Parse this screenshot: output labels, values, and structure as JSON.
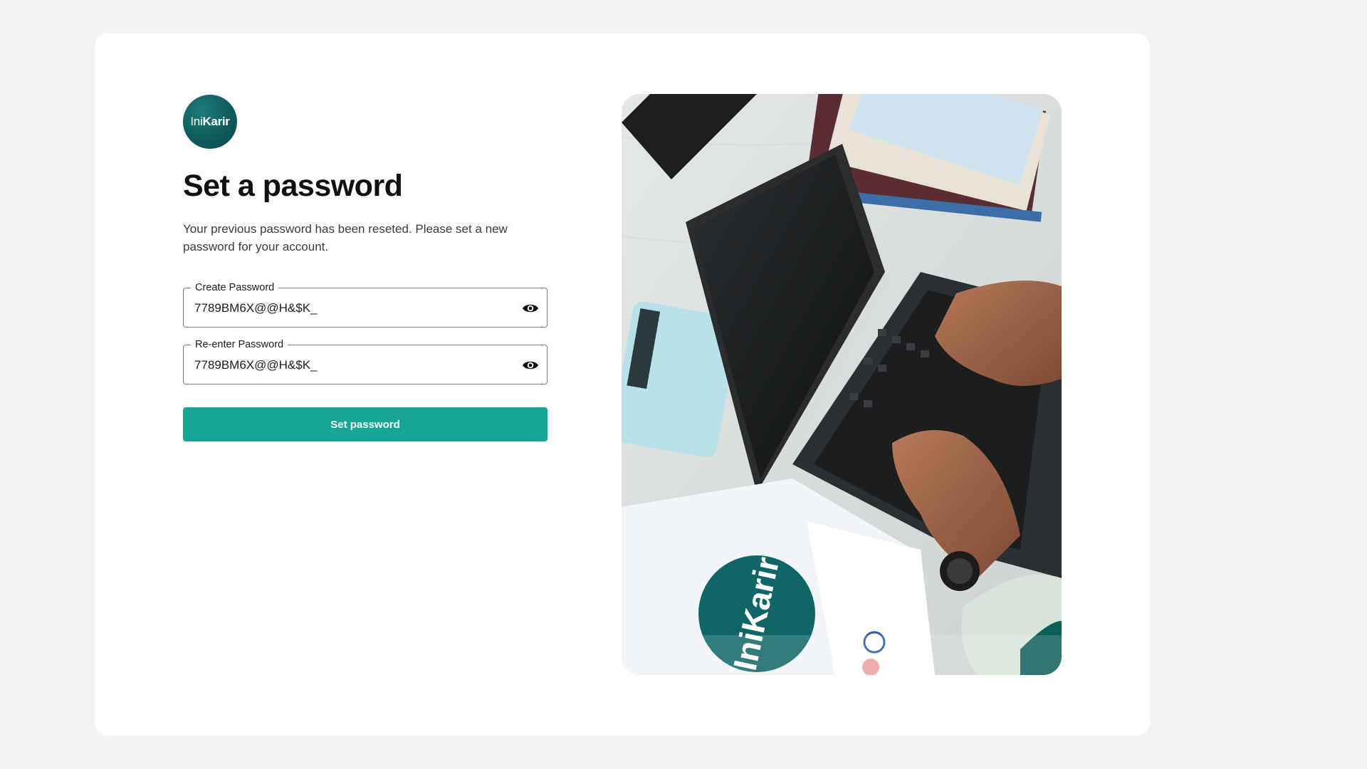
{
  "brand": {
    "prefix": "Ini",
    "suffix": "Karir"
  },
  "page": {
    "title": "Set a password",
    "subtitle": "Your previous password has been reseted. Please set a new password for your account."
  },
  "form": {
    "create_password": {
      "label": "Create Password",
      "value": "7789BM6X@@H&$K_"
    },
    "reenter_password": {
      "label": "Re-enter Password",
      "value": "7789BM6X@@H&$K_"
    },
    "submit_label": "Set password"
  },
  "icons": {
    "visibility": "eye-icon"
  },
  "colors": {
    "accent": "#17a596",
    "brand": "#0f5a5b",
    "background": "#f3f3f3"
  }
}
